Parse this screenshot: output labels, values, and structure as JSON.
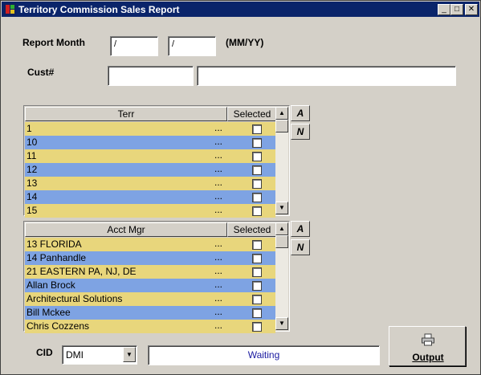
{
  "window": {
    "title": "Territory Commission Sales Report",
    "minimize_glyph": "_",
    "maximize_glyph": "□",
    "close_glyph": "✕"
  },
  "form": {
    "report_month_label": "Report Month",
    "month_value": "/",
    "year_value": "/",
    "format_hint": "(MM/YY)",
    "cust_label": "Cust#",
    "cust_code_value": "",
    "cust_name_value": ""
  },
  "terr_grid": {
    "header_name": "Terr",
    "header_selected": "Selected",
    "rows": [
      {
        "text": "1",
        "dots": "...",
        "checked": false
      },
      {
        "text": "10",
        "dots": "...",
        "checked": false
      },
      {
        "text": "11",
        "dots": "...",
        "checked": false
      },
      {
        "text": "12",
        "dots": "...",
        "checked": false
      },
      {
        "text": "13",
        "dots": "...",
        "checked": false
      },
      {
        "text": "14",
        "dots": "...",
        "checked": false
      },
      {
        "text": "15",
        "dots": "...",
        "checked": false
      }
    ],
    "all_button": "A",
    "none_button": "N"
  },
  "acct_grid": {
    "header_name": "Acct Mgr",
    "header_selected": "Selected",
    "rows": [
      {
        "text": "13 FLORIDA",
        "dots": "...",
        "checked": false
      },
      {
        "text": "14 Panhandle",
        "dots": "...",
        "checked": false
      },
      {
        "text": "21 EASTERN PA, NJ, DE",
        "dots": "...",
        "checked": false
      },
      {
        "text": "Allan Brock",
        "dots": "...",
        "checked": false
      },
      {
        "text": "Architectural Solutions",
        "dots": "...",
        "checked": false
      },
      {
        "text": "Bill Mckee",
        "dots": "...",
        "checked": false
      },
      {
        "text": "Chris Cozzens",
        "dots": "...",
        "checked": false
      }
    ],
    "all_button": "A",
    "none_button": "N"
  },
  "footer": {
    "cid_label": "CID",
    "cid_value": "DMI",
    "status_text": "Waiting",
    "output_label": "Output",
    "output_icon": "printer-icon"
  },
  "colors": {
    "row_yellow": "#e8d67c",
    "row_blue": "#7ea3e3",
    "title_bar": "#0a246a",
    "status_text": "#1a1aa0"
  }
}
